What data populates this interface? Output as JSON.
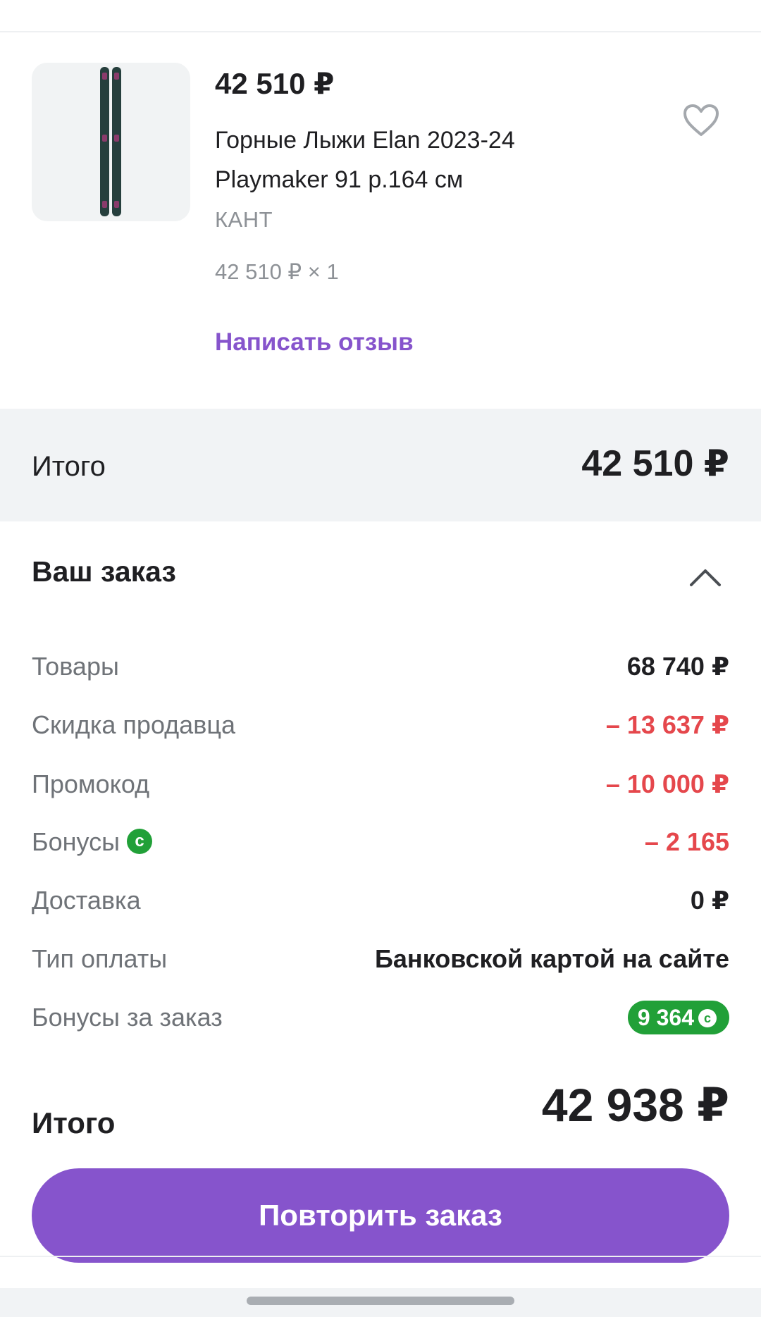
{
  "product": {
    "price": "42 510 ₽",
    "title": "Горные Лыжи Elan 2023-24 Playmaker 91 р.164 см",
    "seller": "КАНТ",
    "unit_price": "42 510 ₽ × 1",
    "review_link": "Написать отзыв",
    "favorite_icon": "heart-outline-icon"
  },
  "total": {
    "label": "Итого",
    "value": "42 510 ₽"
  },
  "order": {
    "title": "Ваш заказ",
    "collapse_icon": "chevron-up-icon",
    "rows": [
      {
        "label": "Товары",
        "value": "68 740 ₽"
      },
      {
        "label": "Скидка продавца",
        "value": "– 13 637 ₽"
      },
      {
        "label": "Промокод",
        "value": "– 10 000 ₽"
      },
      {
        "label": "Бонусы",
        "value": "– 2 165"
      },
      {
        "label": "Доставка",
        "value": "0 ₽"
      },
      {
        "label": "Тип оплаты",
        "value": "Банковской картой на сайте"
      },
      {
        "label": "Бонусы за заказ",
        "value": "9 364"
      }
    ],
    "grand_label": "Итого",
    "grand_value": "42 938 ₽"
  },
  "actions": {
    "repeat": "Повторить заказ"
  },
  "colors": {
    "accent": "#8654cc",
    "discount": "#e5474c",
    "bonus": "#21a038"
  }
}
